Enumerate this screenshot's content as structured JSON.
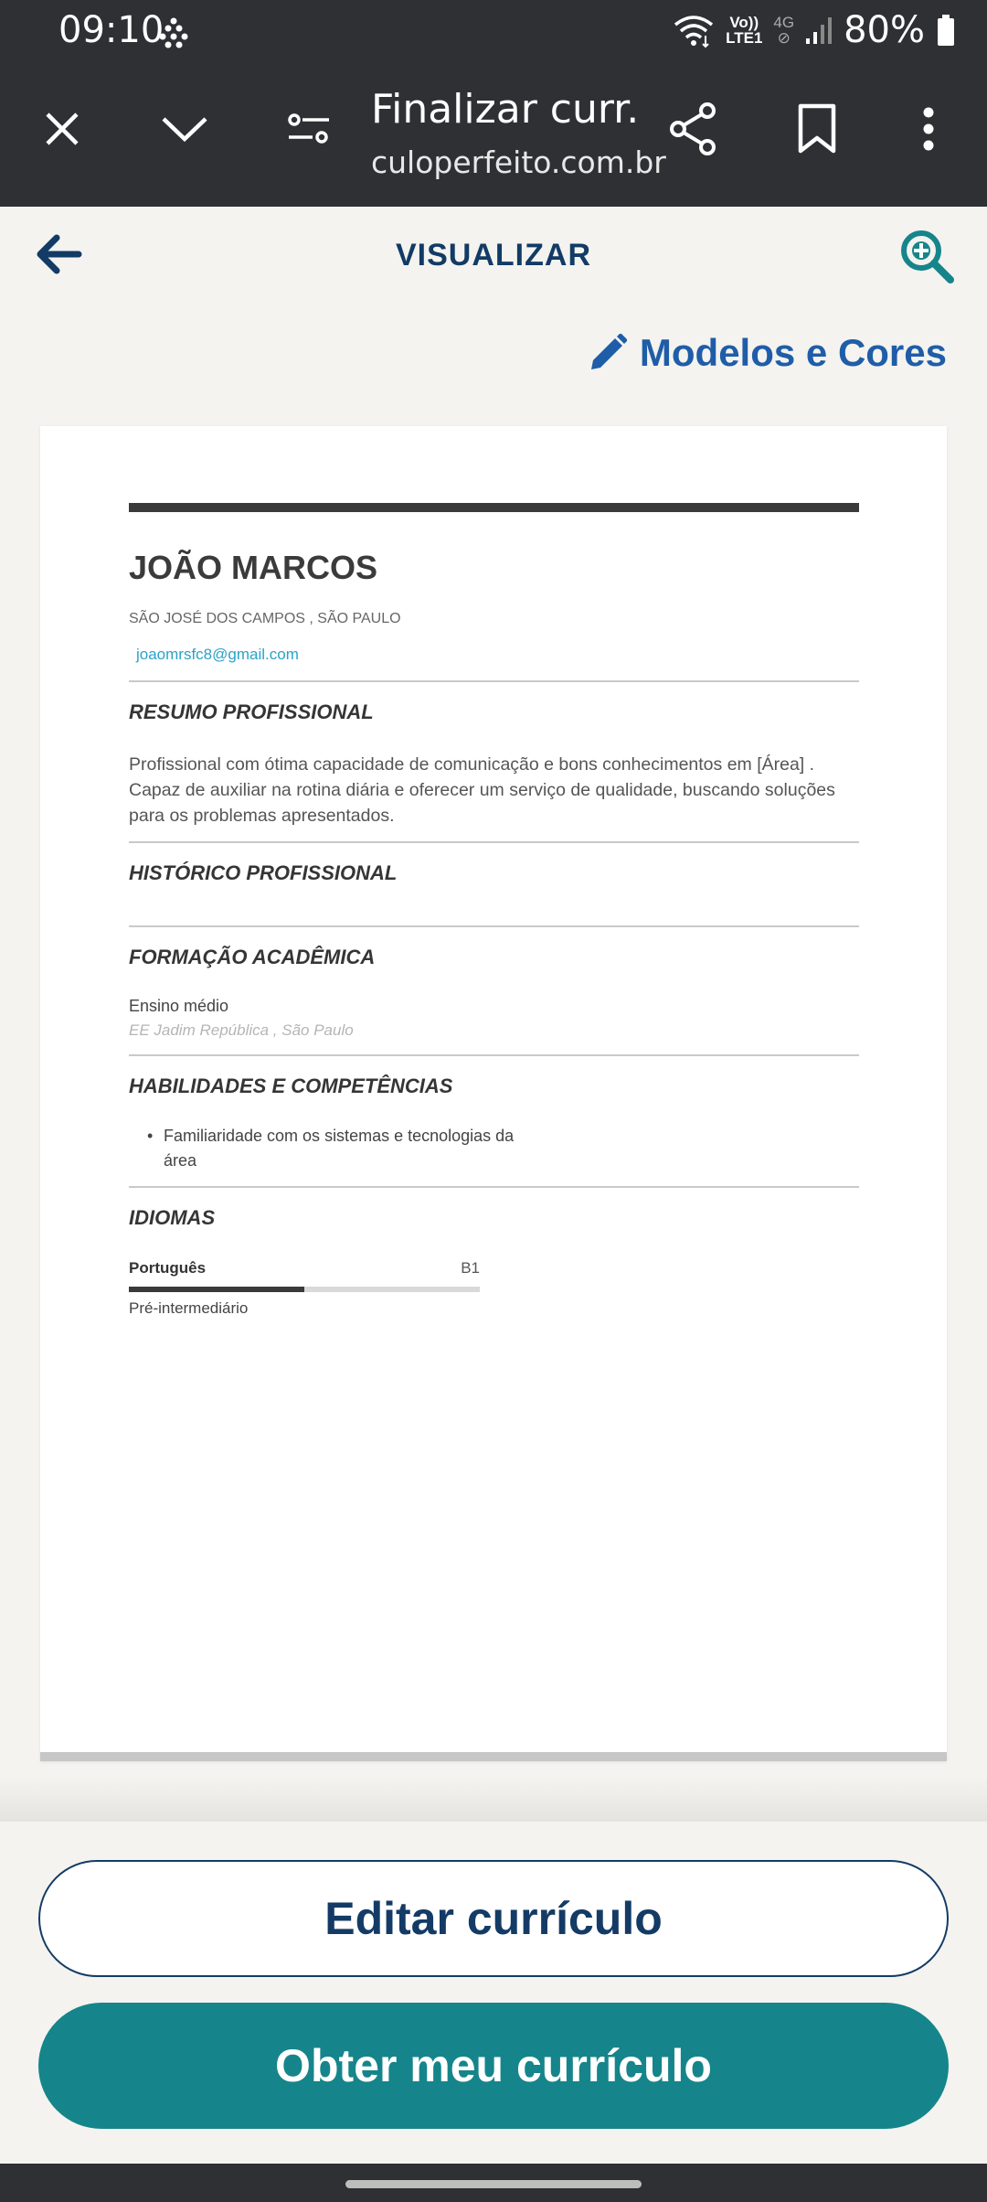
{
  "status_bar": {
    "time": "09:10",
    "volte": "Vo))",
    "lte": "LTE1",
    "net_4g": "4G",
    "battery": "80%"
  },
  "browser": {
    "title": "Finalizar curr...",
    "url": "culoperfeito.com.br"
  },
  "header": {
    "title": "VISUALIZAR",
    "models_link": "Modelos e Cores"
  },
  "resume": {
    "name": "JOÃO MARCOS",
    "location": "SÃO JOSÉ DOS CAMPOS , SÃO PAULO",
    "email": "joaomrsfc8@gmail.com",
    "sections": {
      "summary_title": "RESUMO PROFISSIONAL",
      "summary_text": "Profissional com ótima capacidade de comunicação e bons conhecimentos em [Área] . Capaz de auxiliar na rotina diária e oferecer um serviço de qualidade, buscando soluções para os problemas apresentados.",
      "history_title": "HISTÓRICO PROFISSIONAL",
      "education_title": "FORMAÇÃO ACADÊMICA",
      "education_degree": "Ensino médio",
      "education_school": "EE Jadim República , São Paulo",
      "skills_title": "HABILIDADES E COMPETÊNCIAS",
      "skills_item": "Familiaridade com os sistemas e tecnologias da área",
      "languages_title": "IDIOMAS",
      "language_name": "Português",
      "language_level": "B1",
      "language_level_fraction": 0.5,
      "language_desc": "Pré-intermediário"
    }
  },
  "actions": {
    "edit": "Editar currículo",
    "get": "Obter meu currículo"
  },
  "colors": {
    "primary": "#143b66",
    "accent": "#15858b",
    "link": "#1f5da8",
    "email": "#2aa2c8"
  },
  "icons": [
    "close-icon",
    "chevron-down-icon",
    "page-settings-icon",
    "share-icon",
    "bookmark-icon",
    "more-vert-icon",
    "back-arrow-icon",
    "zoom-icon",
    "pencil-icon",
    "wifi-icon",
    "signal-icon",
    "battery-icon"
  ]
}
